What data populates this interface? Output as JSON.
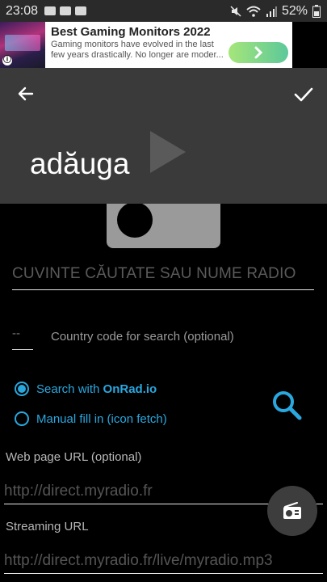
{
  "status_bar": {
    "time": "23:08",
    "battery": "52%",
    "icons": [
      "image-icon",
      "radio-notification-icon",
      "folder-icon",
      "mute-icon",
      "wifi-icon",
      "signal-icon",
      "battery-icon"
    ]
  },
  "ad": {
    "title": "Best Gaming Monitors 2022",
    "text": "Gaming monitors have evolved in the last few years drastically. No longer are moder...",
    "info_icon": "ⓘ",
    "cta_icon": "chevron-right-icon"
  },
  "app_bar": {
    "title": "adăuga",
    "back_icon": "arrow-left-icon",
    "confirm_icon": "check-icon",
    "play_icon": "play-icon",
    "color": "#3a3a3a"
  },
  "form": {
    "search_placeholder": "CUVINTE CĂUTATE SAU NUME RADIO",
    "country_value": "--",
    "country_label": "Country code for search (optional)",
    "option_search_prefix": "Search with ",
    "option_search_brand": "OnRad.io",
    "option_manual": "Manual fill in (icon fetch)",
    "selected_option": "search",
    "web_url_label": "Web page URL (optional)",
    "web_url_placeholder": "http://direct.myradio.fr",
    "stream_url_label": "Streaming URL",
    "stream_url_placeholder": "http://direct.myradio.fr/live/myradio.mp3"
  },
  "accent_color": "#29a8df",
  "fab_icon": "radio-icon"
}
